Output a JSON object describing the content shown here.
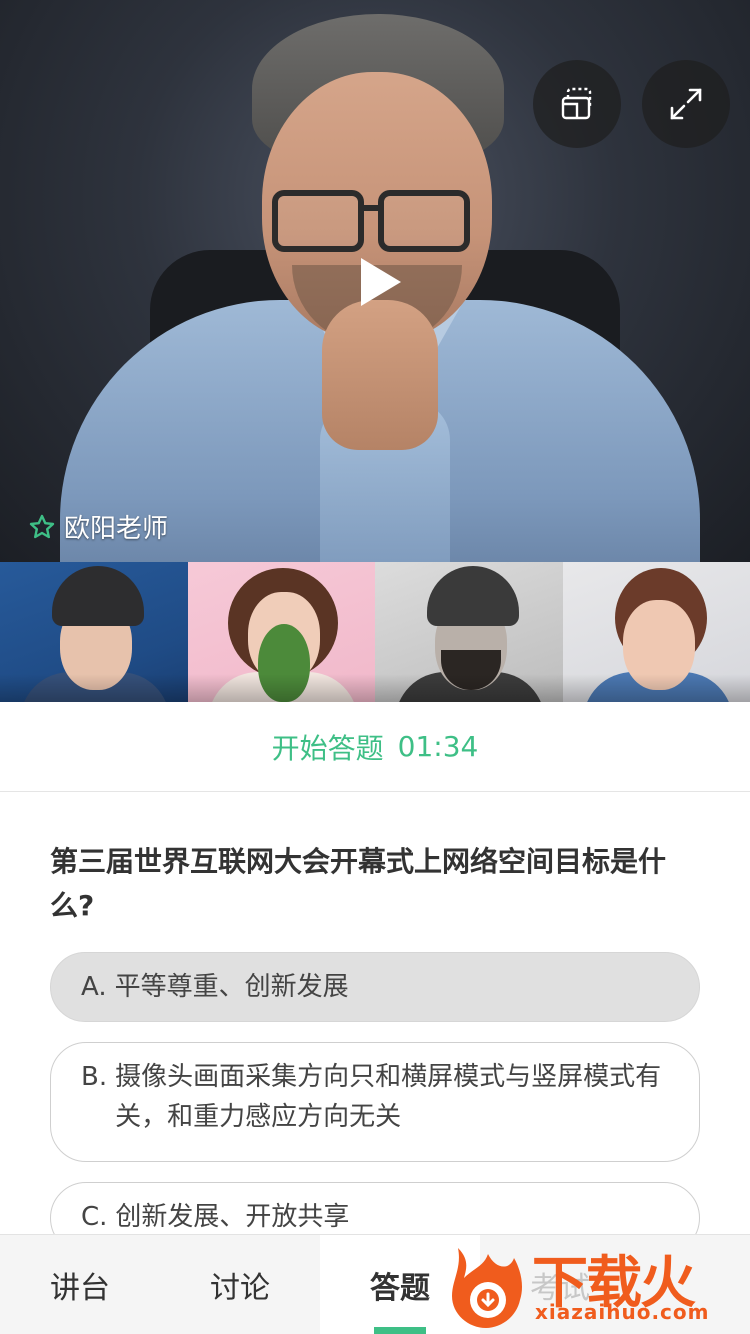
{
  "video": {
    "teacher_name": "欧阳老师",
    "play_icon": "play-icon",
    "switch_icon": "camera-switch-icon",
    "fullscreen_icon": "fullscreen-icon",
    "teacher_icon": "star-icon"
  },
  "thumbnails": [
    {
      "label": "participant-1"
    },
    {
      "label": "participant-2"
    },
    {
      "label": "participant-3"
    },
    {
      "label": "participant-4"
    }
  ],
  "quiz": {
    "status_label": "开始答题",
    "countdown": "01:34",
    "question": "第三届世界互联网大会开幕式上网络空间目标是什么?",
    "options": [
      {
        "letter": "A.",
        "text": "平等尊重、创新发展",
        "selected": true
      },
      {
        "letter": "B.",
        "text": "摄像头画面采集方向只和横屏模式与竖屏模式有关，和重力感应方向无关",
        "selected": false
      },
      {
        "letter": "C.",
        "text": "创新发展、开放共享",
        "selected": false
      }
    ]
  },
  "tabs": [
    {
      "label": "讲台",
      "active": false
    },
    {
      "label": "讨论",
      "active": false
    },
    {
      "label": "答题",
      "active": true
    },
    {
      "label": "考试",
      "active": false
    }
  ],
  "watermark": {
    "text": "下载火",
    "subtext": "xiazaihuo.com"
  },
  "colors": {
    "accent": "#3ebf86",
    "selected_option_bg": "#e0e0e0",
    "watermark": "#f05c1d"
  }
}
